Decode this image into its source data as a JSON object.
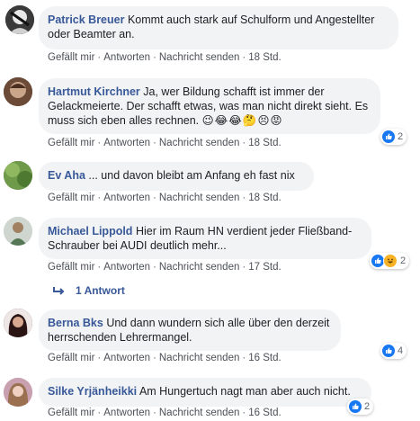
{
  "actions": {
    "like": "Gefällt mir",
    "reply": "Antworten",
    "message": "Nachricht senden",
    "sep": "·"
  },
  "comments": [
    {
      "author": "Patrick Breuer",
      "text": "Kommt auch stark auf Schulform und Angestellter oder Beamter an.",
      "time": "18 Std."
    },
    {
      "author": "Hartmut Kirchner",
      "text": "Ja, wer Bildung schafft ist immer der Gelackmeierte. Der schafft etwas, was man nicht direkt sieht. Es muss sich eben alles rechnen.",
      "emojis": "😉😂😂🤔😣😡",
      "time": "18 Std.",
      "reactions": "2"
    },
    {
      "author": "Ev Aha",
      "text": "... und davon bleibt am Anfang eh fast nix",
      "time": "18 Std."
    },
    {
      "author": "Michael Lippold",
      "text": "Hier im Raum HN verdient jeder Fließband-Schrauber bei AUDI deutlich mehr...",
      "time": "17 Std.",
      "reactions": "2"
    },
    {
      "author": "Berna Bks",
      "text": "Und dann wundern sich alle über den derzeit herrschenden Lehrermangel.",
      "time": "16 Std.",
      "reactions": "4"
    },
    {
      "author": "Silke Yrjänheikki",
      "text": "Am Hungertuch nagt man aber auch nicht.",
      "time": "16 Std.",
      "reactions": "2"
    }
  ],
  "replies": {
    "label": "1 Antwort"
  },
  "colors": {
    "link": "#385898",
    "bubble": "#f2f3f5",
    "like": "#1877f2"
  }
}
